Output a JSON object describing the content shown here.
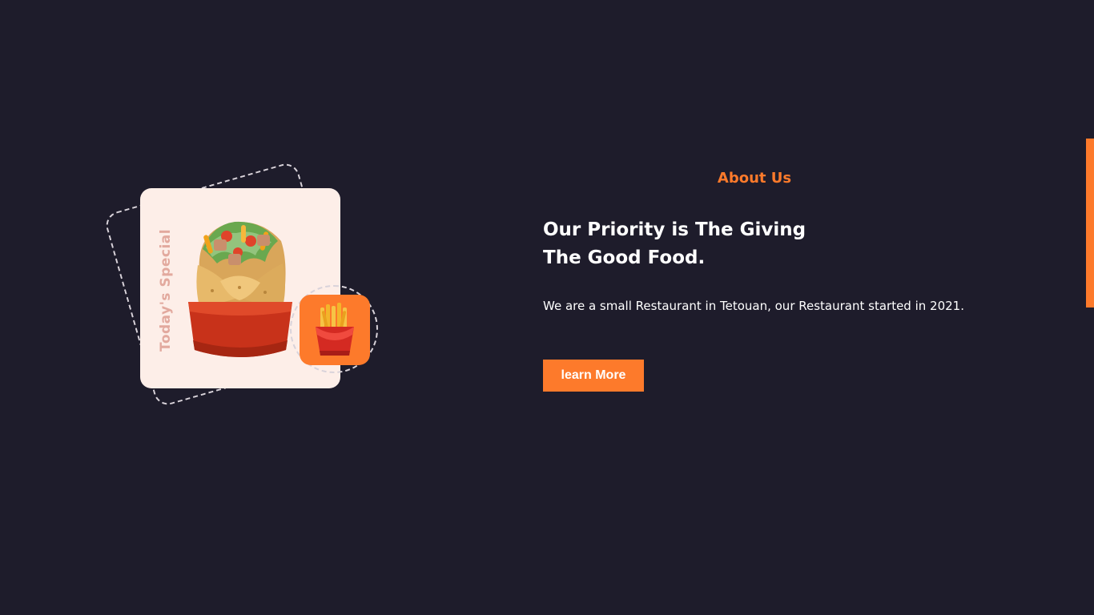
{
  "illustration": {
    "badge_text": "Today's Special",
    "food_icon": "burrito-icon",
    "side_icon": "fries-icon"
  },
  "about": {
    "label": "About Us",
    "headline_line1": "Our Priority is The Giving",
    "headline_line2": "The Good Food.",
    "description": "We are a small Restaurant in Tetouan, our Restaurant started in 2021.",
    "button_label": "learn More"
  },
  "colors": {
    "background": "#1e1c2b",
    "accent": "#fd7a2b",
    "card": "#fdeee8",
    "text": "#ffffff"
  }
}
